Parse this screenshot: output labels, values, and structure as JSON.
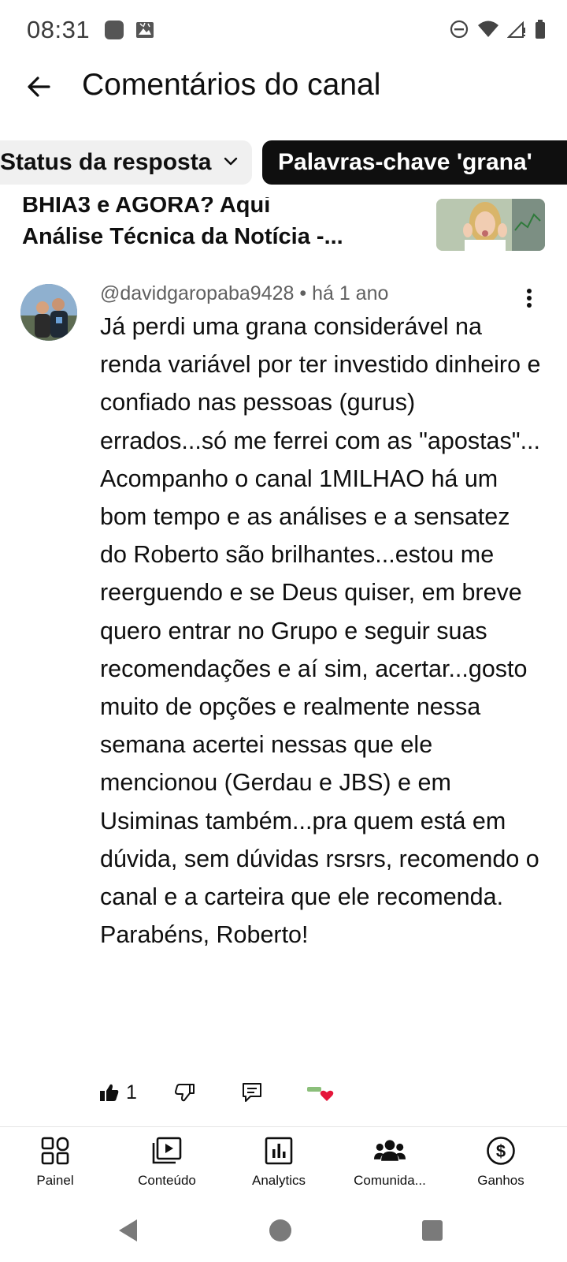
{
  "status_bar": {
    "time": "08:31",
    "icons": [
      "app-notification-icon",
      "gallery-notification-icon",
      "do-not-disturb-icon",
      "wifi-icon",
      "signal-icon",
      "battery-icon"
    ]
  },
  "app_bar": {
    "back_icon": "arrow-left-icon",
    "title": "Comentários do canal"
  },
  "filters": [
    {
      "label": "Status da resposta",
      "selected": false
    },
    {
      "label": "Palavras-chave 'grana'",
      "selected": true
    }
  ],
  "video": {
    "title_line1": "BHIA3 e AGORA? Aqui",
    "title_line2": "Análise Técnica da Notícia  -..."
  },
  "comment": {
    "author": "@davidgaropaba9428",
    "separator": " • ",
    "time": "há 1 ano",
    "text": "Já perdi uma grana considerável na renda variável por ter investido dinheiro e confiado nas pessoas (gurus) errados...só me ferrei com as \"apostas\"...\nAcompanho o canal 1MILHAO há um bom tempo e as análises e a sensatez do Roberto são brilhantes...estou me reerguendo e se Deus quiser, em breve quero entrar no Grupo e seguir suas recomendações e aí sim, acertar...gosto muito de opções e realmente nessa semana acertei nessas que ele mencionou (Gerdau e JBS) e em Usiminas também...pra quem está em dúvida, sem dúvidas rsrsrs, recomendo o canal e a carteira que ele recomenda.\nParabéns, Roberto!",
    "likes": "1"
  },
  "bottom_nav": [
    {
      "label": "Painel",
      "icon": "dashboard-icon"
    },
    {
      "label": "Conteúdo",
      "icon": "content-icon"
    },
    {
      "label": "Analytics",
      "icon": "analytics-icon"
    },
    {
      "label": "Comunida...",
      "icon": "community-icon"
    },
    {
      "label": "Ganhos",
      "icon": "earnings-icon"
    }
  ],
  "colors": {
    "text_primary": "#0f0f0f",
    "text_secondary": "#606060",
    "chip_selected_bg": "#0f0f0f",
    "chip_bg": "#f0f0f0",
    "heart": "#e5163a"
  }
}
